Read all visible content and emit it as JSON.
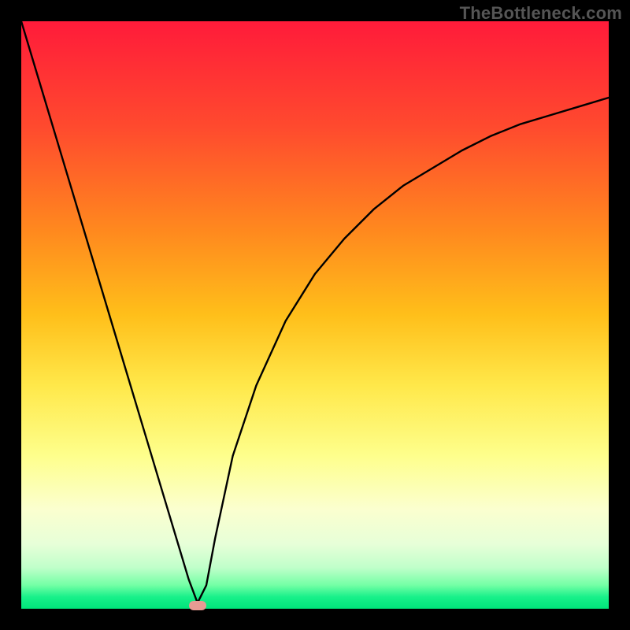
{
  "watermark": {
    "text": "TheBottleneck.com"
  },
  "chart_data": {
    "type": "line",
    "title": "",
    "xlabel": "",
    "ylabel": "",
    "xlim": [
      0,
      100
    ],
    "ylim": [
      0,
      100
    ],
    "grid": false,
    "legend": false,
    "background_gradient": {
      "top_color": "#ff1b3a",
      "bottom_color": "#00e57a",
      "direction": "vertical"
    },
    "series": [
      {
        "name": "bottleneck-curve",
        "color": "#000000",
        "x": [
          0,
          3,
          6,
          9,
          12,
          15,
          18,
          21,
          24,
          27,
          28.5,
          30,
          31.5,
          33,
          36,
          40,
          45,
          50,
          55,
          60,
          65,
          70,
          75,
          80,
          85,
          90,
          95,
          100
        ],
        "values": [
          100,
          90,
          80,
          70,
          60,
          50,
          40,
          30,
          20,
          10,
          5,
          1,
          4,
          12,
          26,
          38,
          49,
          57,
          63,
          68,
          72,
          75,
          78,
          80.5,
          82.5,
          84,
          85.5,
          87
        ]
      }
    ],
    "markers": [
      {
        "name": "optimal-marker",
        "x": 30,
        "y": 0.5,
        "color": "#e89b93",
        "shape": "rounded-rect"
      }
    ]
  }
}
